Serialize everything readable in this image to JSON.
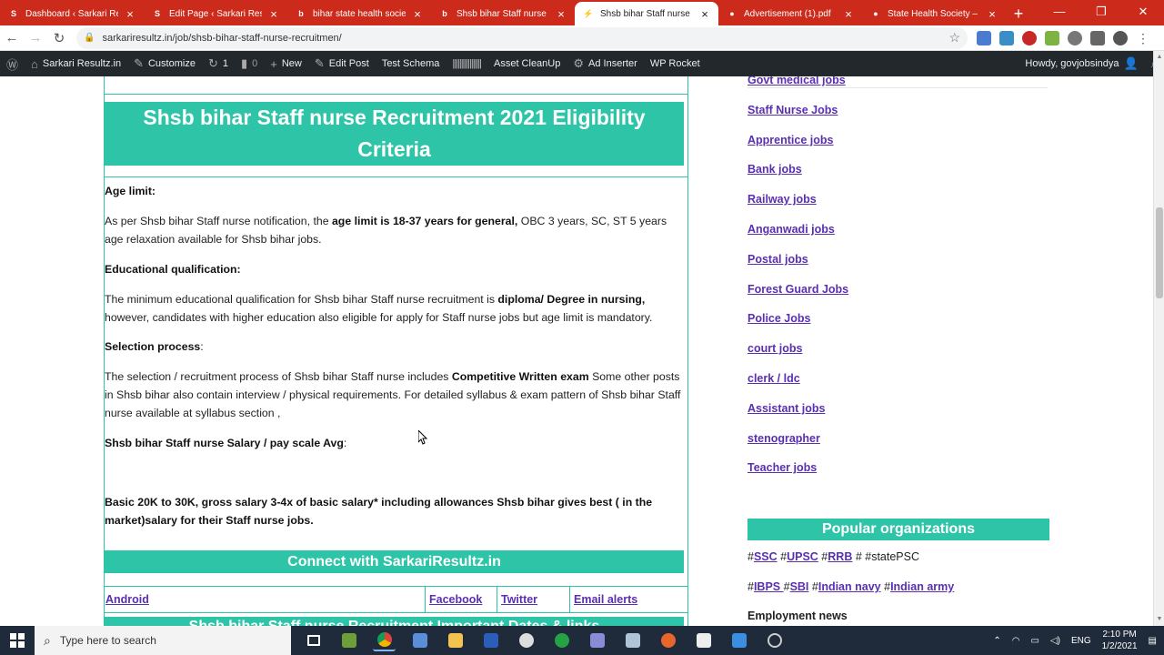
{
  "browser": {
    "tabs": [
      {
        "title": "Dashboard ‹ Sarkari Resu",
        "favicon_color": "#ffffff",
        "favicon_glyph": "S",
        "active": false
      },
      {
        "title": "Edit Page ‹ Sarkari Resul",
        "favicon_color": "#ffffff",
        "favicon_glyph": "S",
        "active": false
      },
      {
        "title": "bihar state health society",
        "favicon_color": "#ffffff",
        "favicon_glyph": "b",
        "active": false
      },
      {
        "title": "Shsb bihar Staff nurse Re",
        "favicon_color": "#ffffff",
        "favicon_glyph": "b",
        "active": false
      },
      {
        "title": "Shsb bihar Staff nurse Re",
        "favicon_color": "#ffffff",
        "favicon_glyph": "⚡",
        "active": true
      },
      {
        "title": "Advertisement (1).pdf",
        "favicon_color": "#ffffff",
        "favicon_glyph": "●",
        "active": false
      },
      {
        "title": "State Health Society – Bi",
        "favicon_color": "#ffffff",
        "favicon_glyph": "●",
        "active": false
      }
    ],
    "url": "sarkariresultz.in/job/shsb-bihar-staff-nurse-recruitmen/"
  },
  "wpbar": {
    "site_name": "Sarkari Resultz.in",
    "customize": "Customize",
    "updates_count": "1",
    "comments_count": "0",
    "new_label": "New",
    "edit_post": "Edit Post",
    "test_schema": "Test Schema",
    "asset_cleanup": "Asset CleanUp",
    "ad_inserter": "Ad Inserter",
    "wp_rocket": "WP Rocket",
    "howdy": "Howdy, govjobsindya"
  },
  "main": {
    "heading": "Shsb bihar Staff nurse Recruitment 2021 Eligibility Criteria",
    "age_label": "Age limit:",
    "age_text_1": "As per Shsb bihar Staff nurse notification, the ",
    "age_bold": "age limit is 18-37 years for general,",
    "age_text_2": " OBC 3 years, SC, ST 5 years age relaxation available for Shsb bihar jobs.",
    "edu_label": "Educational qualification:",
    "edu_text_1": "The minimum educational qualification for Shsb bihar Staff nurse recruitment is ",
    "edu_bold": "diploma/ Degree in nursing,",
    "edu_text_2": " however, candidates with higher education also eligible for apply for Staff nurse jobs but age limit is mandatory.",
    "sel_label": "Selection process",
    "sel_colon": ":",
    "sel_text_1": "The selection / recruitment process of Shsb bihar Staff nurse includes ",
    "sel_bold": "Competitive Written exam",
    "sel_text_2": " Some other posts in Shsb bihar also contain interview / physical requirements. For detailed syllabus & exam pattern of Shsb bihar Staff nurse available at syllabus section ,",
    "salary_label": "Shsb bihar Staff nurse Salary / pay scale Avg",
    "salary_colon": ":",
    "salary_text": "Basic 20K to 30K, gross salary 3-4x of basic salary* including allowances Shsb bihar gives best ( in the market)salary for their Staff nurse jobs.",
    "connect": "Connect with SarkariResultz.in",
    "social": [
      "Android",
      "Facebook",
      "Twitter",
      "Email alerts"
    ],
    "cutoff_heading": "Shsb bihar Staff nurse Recruitment Important Dates & links"
  },
  "sidebar": {
    "links": [
      "Govt medical jobs",
      "Staff Nurse Jobs",
      "Apprentice jobs",
      "Bank jobs",
      "Railway jobs",
      "Anganwadi jobs",
      "Postal jobs",
      "Forest Guard Jobs",
      "Police Jobs",
      "court jobs",
      "clerk / ldc",
      "Assistant jobs",
      "stenographer",
      "Teacher jobs"
    ],
    "popular_title": "Popular organizations",
    "tags_row1": [
      "SSC",
      "UPSC",
      "RRB"
    ],
    "tags_row1_tail": " # #statePSC",
    "tags_row2": [
      "IBPS ",
      "SBI",
      "Indian navy",
      "Indian army"
    ],
    "employment_news": "Employment news"
  },
  "taskbar": {
    "search_placeholder": "Type here to search",
    "lang": "ENG",
    "time": "2:10 PM",
    "date": "1/2/2021"
  }
}
